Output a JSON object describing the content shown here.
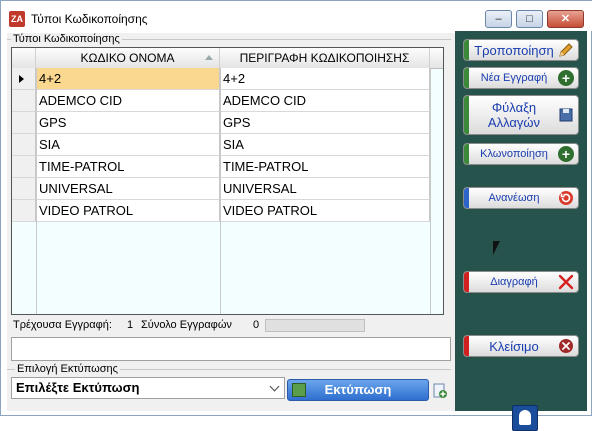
{
  "window": {
    "title": "Τύποι Κωδικοποίησης",
    "app_icon_text": "ZA",
    "controls": {
      "min": "–",
      "max": "□",
      "close": "✕"
    }
  },
  "group": {
    "label": "Τύποι Κωδικοποίησης"
  },
  "grid": {
    "columns": [
      "ΚΩΔΙΚΟ ΟΝΟΜΑ",
      "ΠΕΡΙΓΡΑΦΗ ΚΩΔΙΚΟΠΟΙΗΣΗΣ"
    ],
    "rows": [
      [
        "4+2",
        "4+2"
      ],
      [
        "ADEMCO CID",
        "ADEMCO CID"
      ],
      [
        "GPS",
        "GPS"
      ],
      [
        "SIA",
        "SIA"
      ],
      [
        "TIME-PATROL",
        "TIME-PATROL"
      ],
      [
        "UNIVERSAL",
        "UNIVERSAL"
      ],
      [
        "VIDEO PATROL",
        "VIDEO PATROL"
      ]
    ],
    "selected_row": 0,
    "selected_color": "#fbd88f",
    "background_color": "#f2feff"
  },
  "status": {
    "current_label": "Τρέχουσα Εγγραφή:",
    "current_value": "1",
    "total_label": "Σύνολο Εγγραφών",
    "total_value": "0"
  },
  "print": {
    "group_label": "Επιλογή Εκτύπωσης",
    "select_value": "Επιλέξτε Εκτύπωση",
    "button_label": "Εκτύπωση"
  },
  "sidebar": {
    "background_color": "#26544d",
    "buttons": [
      {
        "label": "Τροποποίηση",
        "accent": "#3a8a3a",
        "icon": "pencil-icon"
      },
      {
        "label": "Νέα Εγγραφή",
        "accent": "#3a8a3a",
        "icon": "plus-icon"
      },
      {
        "label": "Φύλαξη Αλλαγών",
        "accent": "#3a8a3a",
        "icon": "save-icon"
      },
      {
        "label": "Κλωνοποίηση",
        "accent": "#3a8a3a",
        "icon": "plus-icon"
      },
      {
        "label": "Ανανέωση",
        "accent": "#2d64c8",
        "icon": "refresh-icon"
      },
      {
        "label": "Διαγραφή",
        "accent": "#d02020",
        "icon": "delete-x-icon"
      },
      {
        "label": "Κλείσιμο",
        "accent": "#d02020",
        "icon": "close-circle-icon"
      }
    ]
  }
}
